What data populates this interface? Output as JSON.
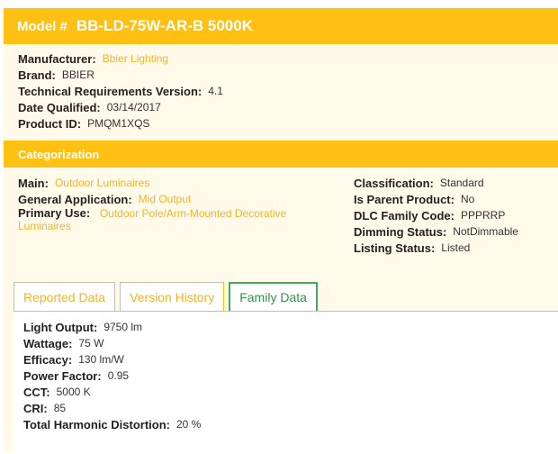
{
  "header": {
    "model_label": "Model #",
    "model_value": "BB-LD-75W-AR-B 5000K"
  },
  "info": [
    {
      "key": "Manufacturer:",
      "value": "Bbier Lighting",
      "link": true
    },
    {
      "key": "Brand:",
      "value": "BBIER",
      "link": false
    },
    {
      "key": "Technical Requirements Version:",
      "value": "4.1",
      "link": false
    },
    {
      "key": "Date Qualified:",
      "value": "03/14/2017",
      "link": false
    },
    {
      "key": "Product ID:",
      "value": "PMQM1XQS",
      "link": false
    }
  ],
  "categorization": {
    "title": "Categorization",
    "left": [
      {
        "key": "Main:",
        "value": "Outdoor Luminaires"
      },
      {
        "key": "General Application:",
        "value": "Mid Output"
      },
      {
        "key": "Primary Use:",
        "value": "Outdoor Pole/Arm-Mounted Decorative Luminaires"
      }
    ],
    "right": [
      {
        "key": "Classification:",
        "value": "Standard"
      },
      {
        "key": "Is Parent Product:",
        "value": "No"
      },
      {
        "key": "DLC Family Code:",
        "value": "PPPRRP"
      },
      {
        "key": "Dimming Status:",
        "value": "NotDimmable"
      },
      {
        "key": "Listing Status:",
        "value": "Listed"
      }
    ]
  },
  "tabs": [
    {
      "label": "Reported Data"
    },
    {
      "label": "Version History"
    },
    {
      "label": "Family Data"
    }
  ],
  "reported": [
    {
      "key": "Light Output:",
      "value": "9750 lm"
    },
    {
      "key": "Wattage:",
      "value": "75 W"
    },
    {
      "key": "Efficacy:",
      "value": "130 lm/W"
    },
    {
      "key": "Power Factor:",
      "value": "0.95"
    },
    {
      "key": "CCT:",
      "value": "5000 K"
    },
    {
      "key": "CRI:",
      "value": "85"
    },
    {
      "key": "Total Harmonic Distortion:",
      "value": "20 %"
    }
  ],
  "colors": {
    "accent": "#fec012",
    "link": "#f0b428",
    "active_tab": "#3fae5b"
  }
}
